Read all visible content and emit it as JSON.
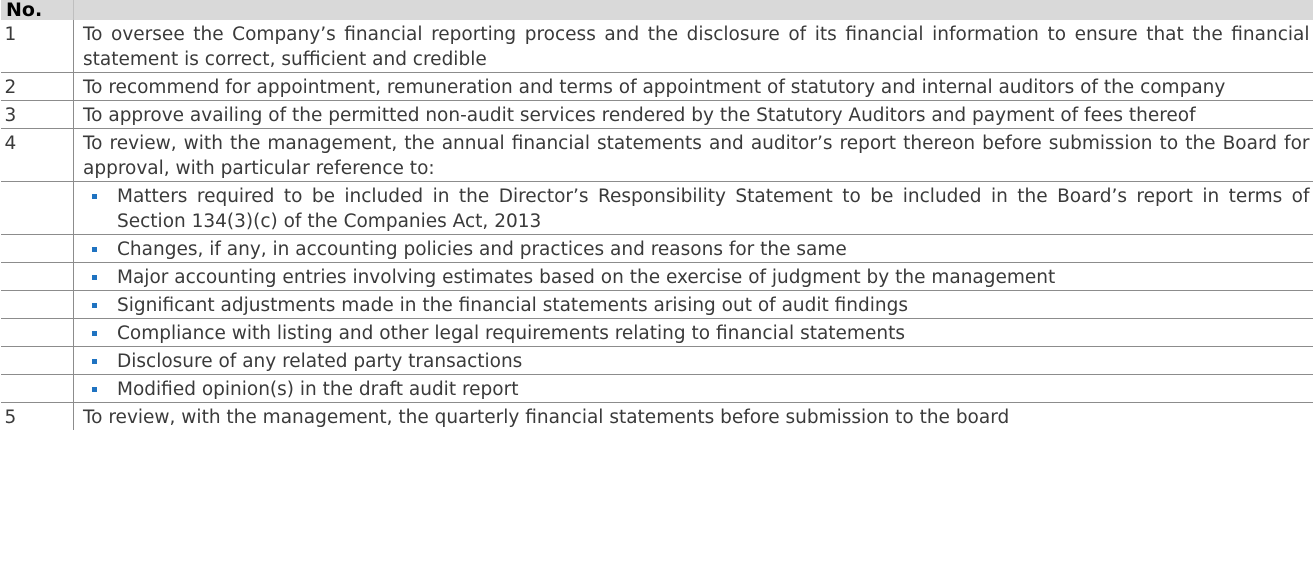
{
  "table": {
    "header": {
      "no": "No.",
      "text": ""
    },
    "rows": [
      {
        "kind": "item",
        "no": "1",
        "text": "To oversee the Company’s financial reporting process and the disclosure of its financial information to ensure that the financial statement is correct, sufficient and credible"
      },
      {
        "kind": "item",
        "no": "2",
        "text": "To recommend for appointment, remuneration and terms of appointment of statutory and internal auditors of the company"
      },
      {
        "kind": "item",
        "no": "3",
        "text": "To approve availing of the permitted non-audit services rendered by the Statutory Auditors and payment of fees thereof"
      },
      {
        "kind": "item",
        "no": "4",
        "text": "To review, with the management, the annual financial statements and auditor’s report thereon before submission to the Board for approval, with particular reference to:"
      },
      {
        "kind": "bullet",
        "no": "",
        "text": "Matters required to be included in the Director’s Responsibility Statement to be included in the Board’s report in terms of Section 134(3)(c) of the Companies Act, 2013"
      },
      {
        "kind": "bullet",
        "no": "",
        "text": "Changes, if any, in accounting policies and practices and reasons for the same"
      },
      {
        "kind": "bullet",
        "no": "",
        "text": "Major accounting entries involving estimates based on the exercise of judgment by the management"
      },
      {
        "kind": "bullet",
        "no": "",
        "text": "Significant adjustments made in the financial statements arising out of audit findings"
      },
      {
        "kind": "bullet",
        "no": "",
        "text": "Compliance with listing and other legal requirements relating to financial statements"
      },
      {
        "kind": "bullet",
        "no": "",
        "text": "Disclosure of any related party transactions"
      },
      {
        "kind": "bullet",
        "no": "",
        "text": "Modified opinion(s) in the draft audit report"
      },
      {
        "kind": "item",
        "no": "5",
        "text": "To review, with the management, the quarterly financial statements before submission to the board"
      }
    ]
  },
  "colors": {
    "header_bg": "#d9d9d9",
    "bullet": "#1f73c1",
    "rule": "#8c8c8c",
    "text": "#3a3a3a"
  }
}
